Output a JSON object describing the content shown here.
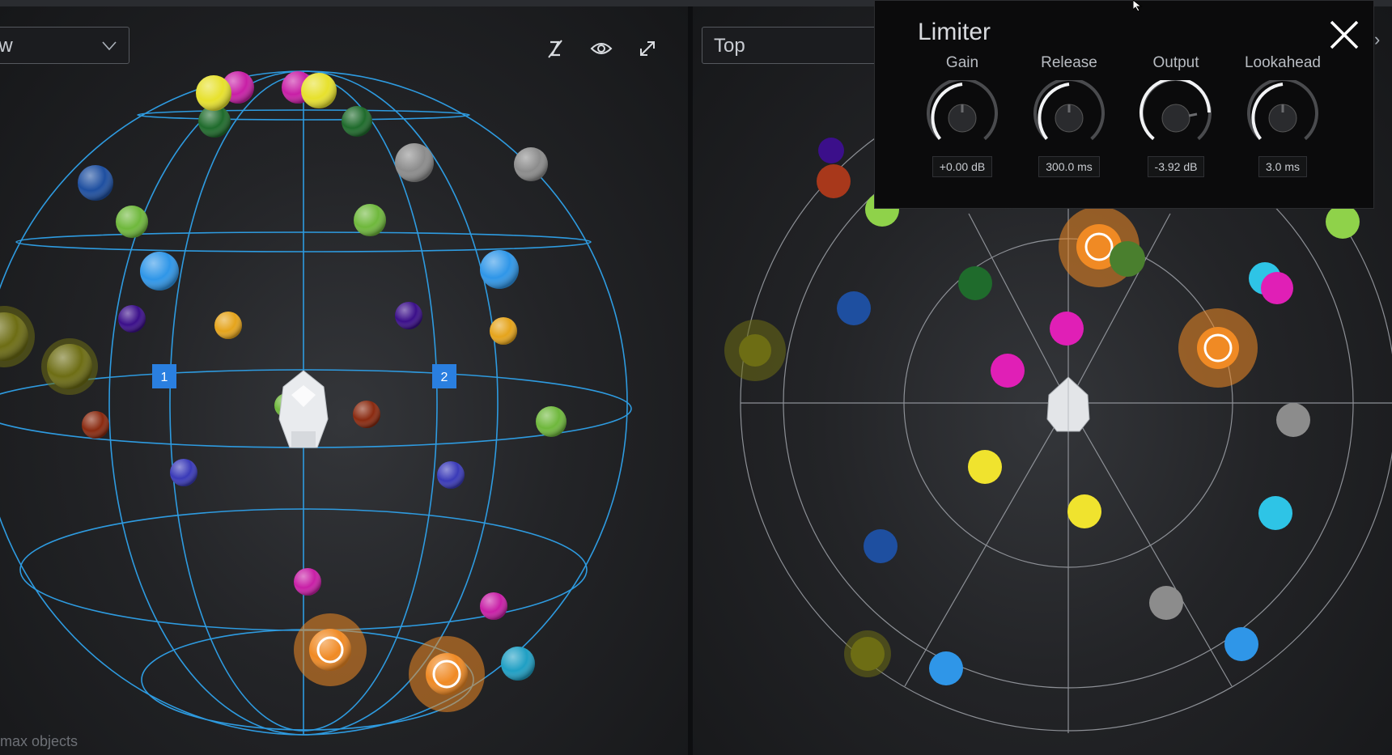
{
  "left_view": {
    "dropdown_value": "ew",
    "speaker_labels": [
      "1",
      "2"
    ],
    "footer_text": "max objects",
    "toolbar": {
      "icons": [
        "mute-visibility-icon",
        "eye-icon",
        "expand-icon"
      ]
    }
  },
  "right_view": {
    "dropdown_value": "Top"
  },
  "limiter": {
    "title": "Limiter",
    "close_icon": "close-icon",
    "controls": [
      {
        "label": "Gain",
        "value_text": "+0.00 dB"
      },
      {
        "label": "Release",
        "value_text": "300.0 ms"
      },
      {
        "label": "Output",
        "value_text": "-3.92 dB"
      },
      {
        "label": "Lookahead",
        "value_text": "3.0 ms"
      }
    ]
  },
  "colors": {
    "grid_blue": "#2e9be0",
    "accent_orange": "#f08a24",
    "speaker_blue": "#2a7fe0",
    "panel_dark": "#232427"
  }
}
